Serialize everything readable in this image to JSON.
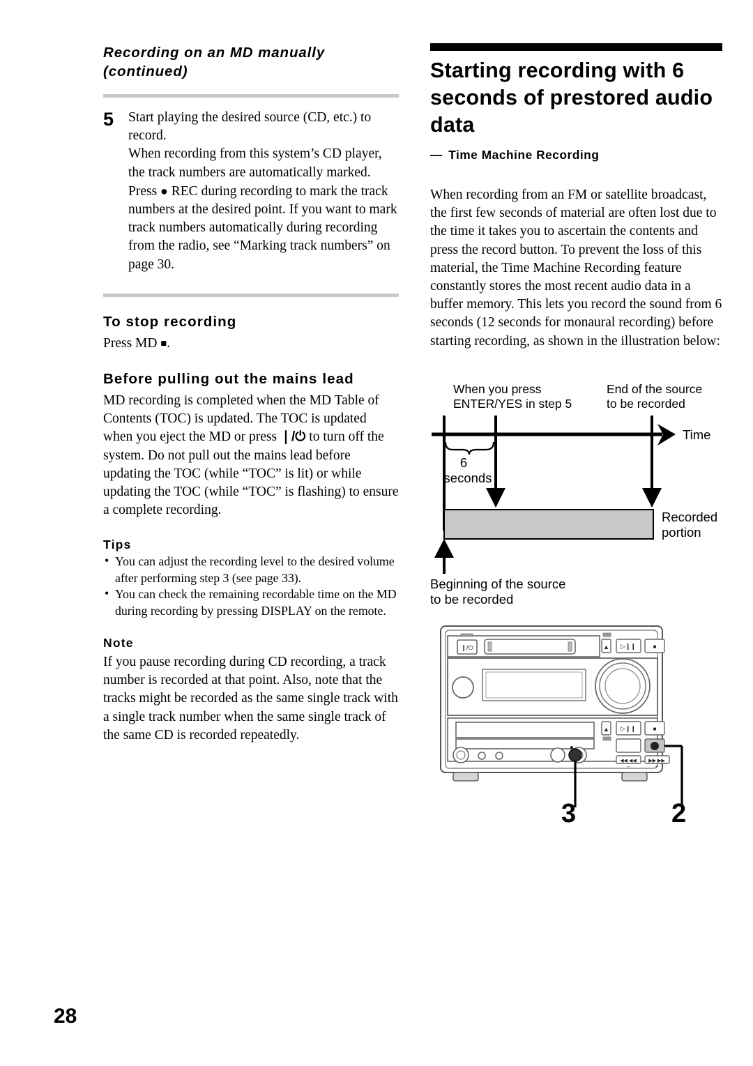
{
  "page": {
    "number": "28"
  },
  "left_column": {
    "running_head_line1": "Recording on an MD manually",
    "running_head_line2": "(continued)",
    "step": {
      "number": "5",
      "title": "Start playing the desired source (CD, etc.) to record.",
      "detail_part1": "When recording from this system’s CD player, the track numbers are automatically marked. Press ",
      "detail_rec_icon": "●",
      "detail_part2": " REC during recording to mark the track numbers at the desired point. If you want to mark track numbers automatically during recording from the radio, see “Marking track numbers” on page 30."
    },
    "stop_recording": {
      "heading": "To stop recording",
      "text_prefix": "Press MD ",
      "stop_icon": "■",
      "text_suffix": "."
    },
    "mains_lead": {
      "heading": "Before pulling out the mains lead",
      "text_part1": "MD recording is completed when the MD Table of Contents (TOC) is updated. The TOC is updated when you eject the MD or press ",
      "power_icon": "❘/⏻",
      "text_part2": " to turn off the system. Do not pull out the mains lead before updating the TOC (while “TOC” is lit) or while updating the TOC (while “TOC” is flashing) to ensure a complete recording."
    },
    "tips": {
      "heading": "Tips",
      "items": [
        "You can adjust the recording level to the desired volume after performing step 3 (see page 33).",
        "You can check the remaining recordable time on the MD during recording by pressing DISPLAY on the remote."
      ]
    },
    "note": {
      "heading": "Note",
      "text": "If you pause recording during CD recording, a track number is recorded at that point. Also, note that the tracks might be recorded as the same single track with a single track number when the same single track of the same CD is recorded repeatedly."
    }
  },
  "right_column": {
    "chapter_title": "Starting recording with 6 seconds of prestored audio data",
    "chapter_subtitle_dash": "—",
    "chapter_subtitle": "Time Machine Recording",
    "intro_paragraph": "When recording from an FM or satellite broadcast, the first few seconds of material are often lost due to the time it takes you to ascertain the contents and press the record button. To prevent the loss of this material, the Time Machine Recording feature constantly stores the most recent audio data in a buffer memory. This lets you record the sound from 6 seconds (12 seconds for monaural recording) before starting recording, as shown in the illustration below:"
  },
  "timeline_figure": {
    "label_press_line1": "When you press",
    "label_press_line2": "ENTER/YES in step 5",
    "label_end_line1": "End of the source",
    "label_end_line2": "to be recorded",
    "label_time": "Time",
    "label_duration_value": "6",
    "label_duration_unit": "seconds",
    "label_recorded_line1": "Recorded",
    "label_recorded_line2": "portion",
    "label_begin_line1": "Beginning of the source",
    "label_begin_line2": "to be recorded",
    "recorded_bar_color": "#c8c8c8"
  },
  "device_figure": {
    "callout_left": "3",
    "callout_right": "2",
    "power_button_icon": "❘/⏻",
    "eject_icon": "▲",
    "play_pause_icon": "▷‖",
    "stop_icon": "■",
    "rec_icon": "●",
    "prev_icon": "◀◀",
    "next_icon": "▶▶"
  }
}
